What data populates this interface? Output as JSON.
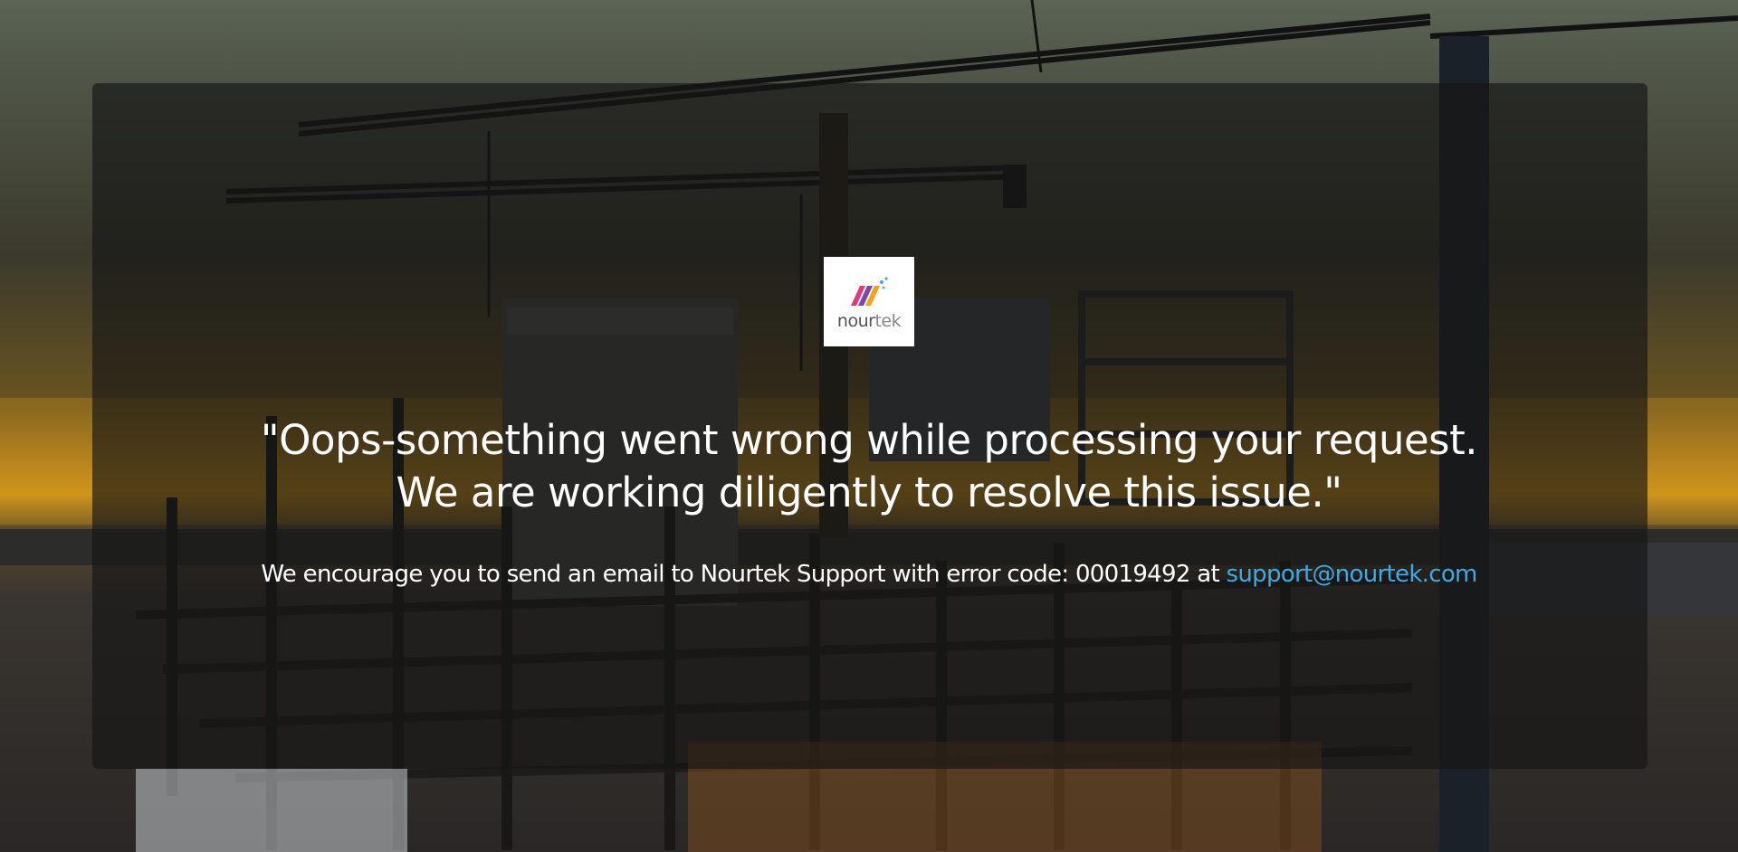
{
  "brand": {
    "logo_text_main": "nour",
    "logo_text_accent": "tek",
    "logo_colors": [
      "#e23a78",
      "#f2a21b",
      "#7a4aa8",
      "#3fa9e4"
    ]
  },
  "error": {
    "headline_line1": "\"Oops-something went wrong while processing your request.",
    "headline_line2": "We are working diligently to resolve this issue.\"",
    "support_prefix": "We encourage you to send an email to Nourtek Support with error code: 00019492 at ",
    "support_email": "support@nourtek.com"
  },
  "colors": {
    "link": "#3fa9e4",
    "panel": "rgba(22,22,22,0.66)"
  }
}
